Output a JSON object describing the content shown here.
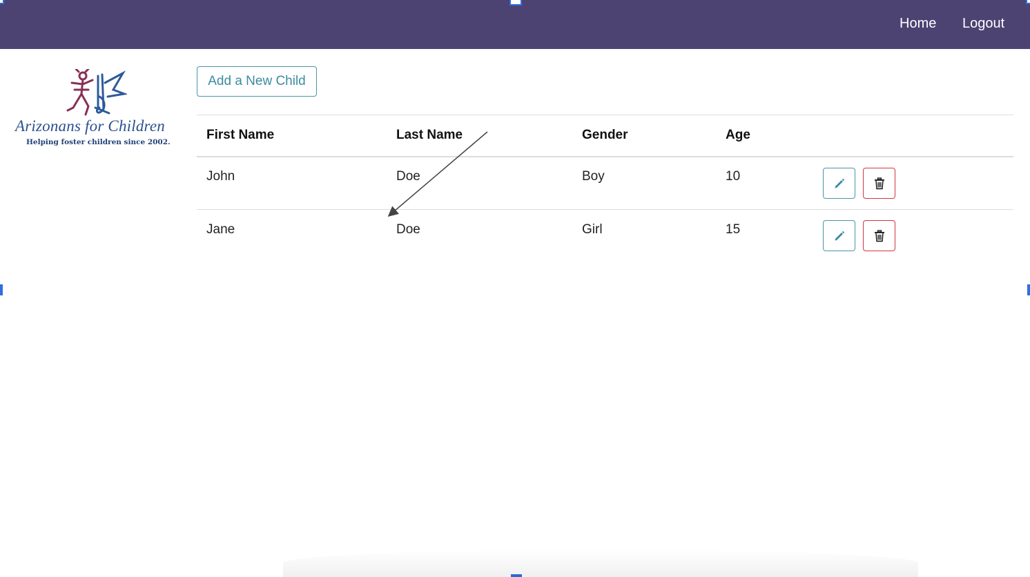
{
  "nav": {
    "home": "Home",
    "logout": "Logout"
  },
  "logo": {
    "name": "Arizonans for Children",
    "tagline": "Helping foster children since 2002."
  },
  "add_button": "Add a New Child",
  "table": {
    "headers": [
      "First Name",
      "Last Name",
      "Gender",
      "Age"
    ],
    "rows": [
      {
        "first_name": "John",
        "last_name": "Doe",
        "gender": "Boy",
        "age": "10"
      },
      {
        "first_name": "Jane",
        "last_name": "Doe",
        "gender": "Girl",
        "age": "15"
      }
    ]
  },
  "icons": {
    "edit": "pencil-icon",
    "delete": "trash-icon"
  },
  "colors": {
    "navbar": "#4c4372",
    "accent": "#3c8ba0",
    "danger": "#d2353f",
    "selection": "#2f6fde"
  }
}
